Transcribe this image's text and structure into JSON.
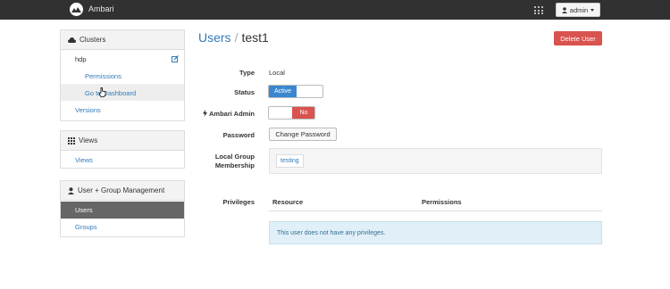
{
  "topbar": {
    "brand": "Ambari",
    "user_menu_label": "admin"
  },
  "sidebar": {
    "clusters": {
      "heading": "Clusters",
      "cluster_name": "hdp",
      "items": [
        "Permissions",
        "Go to Dashboard",
        "Versions"
      ]
    },
    "views": {
      "heading": "Views",
      "items": [
        "Views"
      ]
    },
    "user_group": {
      "heading": "User + Group Management",
      "items": [
        "Users",
        "Groups"
      ]
    }
  },
  "main": {
    "breadcrumb_parent": "Users",
    "breadcrumb_separator": "/",
    "breadcrumb_current": "test1",
    "delete_label": "Delete User",
    "fields": {
      "type_label": "Type",
      "type_value": "Local",
      "status_label": "Status",
      "status_on": "Active",
      "admin_label": "Ambari Admin",
      "admin_off": "No",
      "password_label": "Password",
      "password_button": "Change Password",
      "group_label_line1": "Local Group",
      "group_label_line2": "Membership",
      "groups": [
        "testing"
      ]
    },
    "privileges": {
      "label": "Privileges",
      "col_resource": "Resource",
      "col_permissions": "Permissions",
      "empty_message": "This user does not have any privileges."
    }
  },
  "colors": {
    "topbar": "#313131",
    "link": "#337ab7",
    "danger": "#d9534f",
    "primary": "#3a87cf",
    "active_nav": "#666666",
    "info_bg": "#e1eff8"
  }
}
